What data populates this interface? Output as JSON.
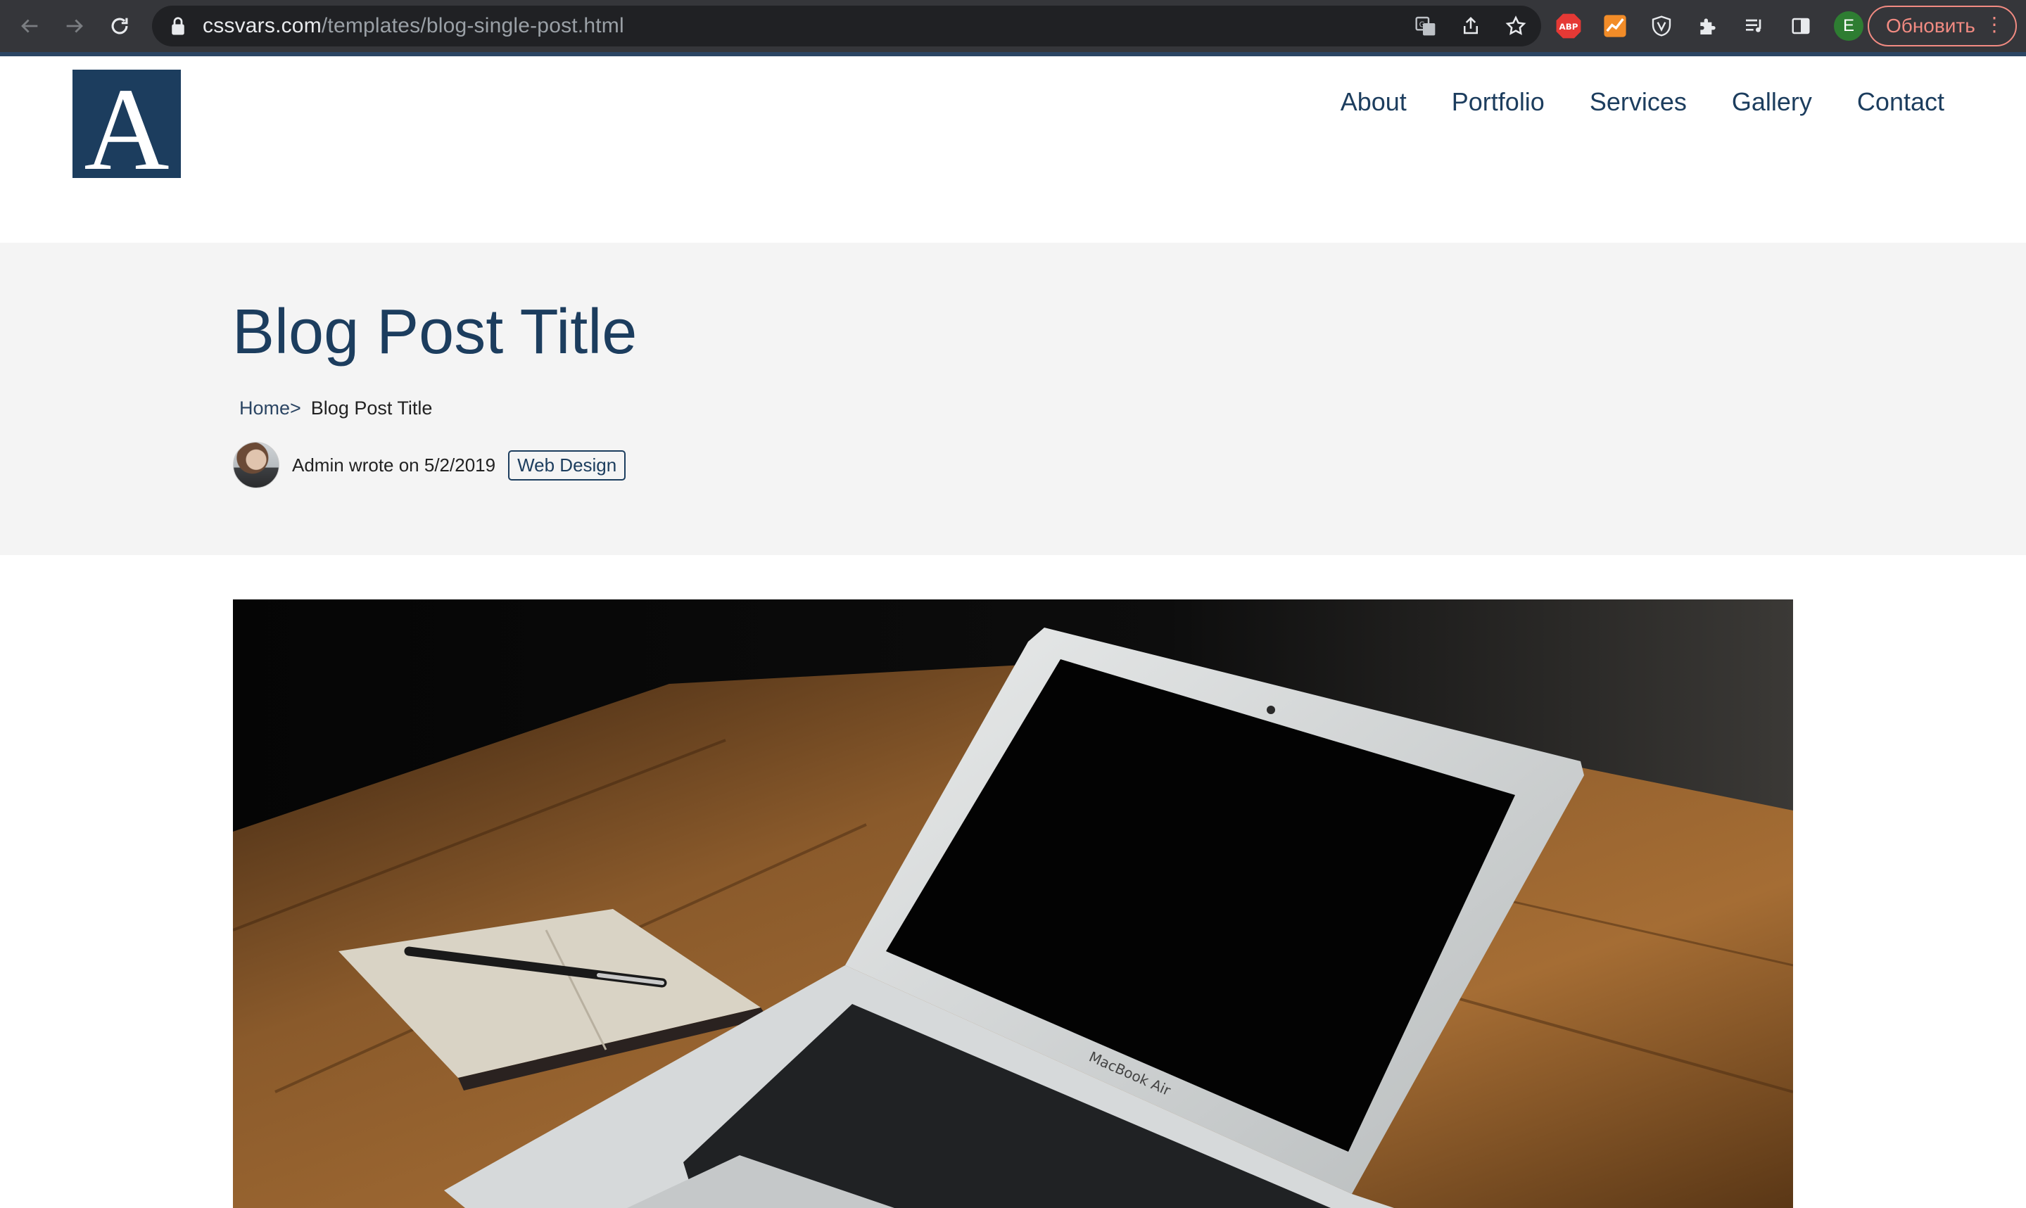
{
  "browser": {
    "url_host": "cssvars.com",
    "url_path": "/templates/blog-single-post.html",
    "update_label": "Обновить",
    "profile_initial": "E",
    "icons": [
      "back-arrow-icon",
      "forward-arrow-icon",
      "reload-icon",
      "lock-icon",
      "translate-icon",
      "share-icon",
      "star-icon",
      "adblock-icon",
      "analytics-extension-icon",
      "shield-extension-icon",
      "puzzle-extensions-icon",
      "media-queue-icon",
      "side-panel-icon",
      "kebab-menu-icon"
    ],
    "adblock_label": "ABP"
  },
  "site": {
    "logo_letter": "A",
    "nav": [
      "About",
      "Portfolio",
      "Services",
      "Gallery",
      "Contact"
    ],
    "colors": {
      "brand": "#1c3d5e",
      "hero_bg": "#f4f4f4"
    }
  },
  "post": {
    "title": "Blog Post Title",
    "breadcrumb": {
      "home": "Home>",
      "current": "Blog Post Title"
    },
    "meta": "Admin wrote on 5/2/2019",
    "category": "Web Design",
    "laptop_label": "MacBook Air"
  }
}
